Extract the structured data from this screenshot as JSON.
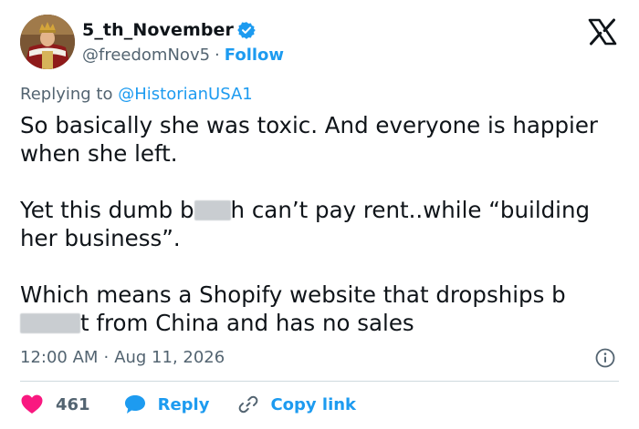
{
  "author": {
    "display_name": "5_th_November",
    "handle": "@freedomNov5",
    "separator": "·",
    "follow_label": "Follow",
    "verified_color": "#1d9bf0"
  },
  "reply_to": {
    "prefix": "Replying to",
    "mention": "@HistorianUSA1"
  },
  "tweet": {
    "p1": "So basically she was toxic.  And everyone is happier when she left.",
    "p2_a": "Yet this dumb b",
    "p2_b": "h can’t pay rent..while “building her business”.",
    "p3_a": "Which means a Shopify website that dropships b",
    "p3_b": "t from China and has no sales"
  },
  "meta": {
    "time": "12:00 AM",
    "separator": "·",
    "date": "Aug 11, 2026"
  },
  "actions": {
    "like_count": "461",
    "reply_label": "Reply",
    "copy_label": "Copy link"
  },
  "colors": {
    "accent": "#1d9bf0",
    "like": "#f91880",
    "secondary_text": "#536471",
    "divider": "#cfd9de"
  },
  "icons": [
    "verified-badge-icon",
    "x-logo-icon",
    "info-icon",
    "heart-icon",
    "reply-bubble-icon",
    "link-icon"
  ]
}
